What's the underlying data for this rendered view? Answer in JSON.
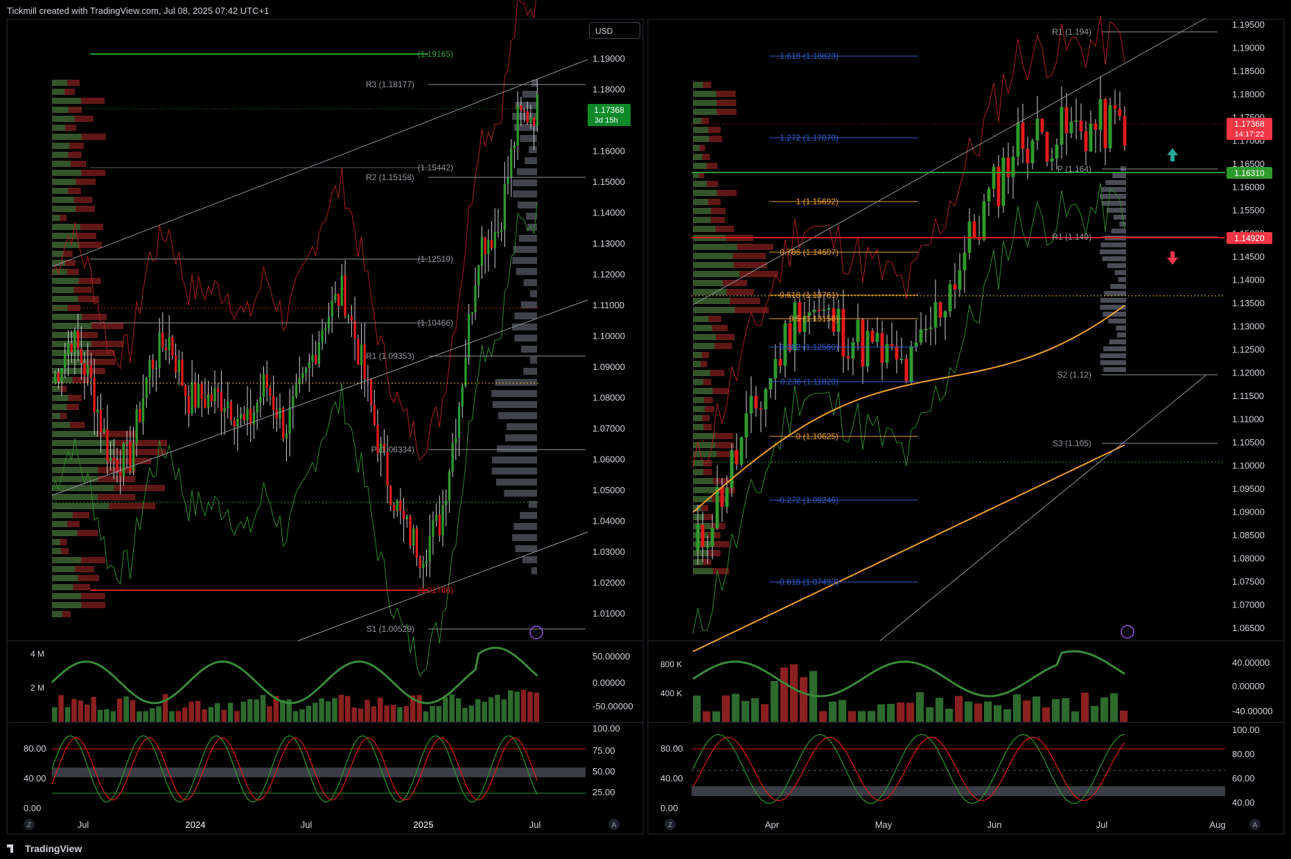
{
  "header": {
    "attribution": "Tickmill created with TradingView.com, Jul 08, 2025 07:42 UTC+1"
  },
  "footer": {
    "brand": "TradingView"
  },
  "colors": {
    "bull": "#2e8b2e",
    "bear": "#e21b1b",
    "grid": "#1c1f26",
    "text": "#d1d4dc",
    "pivot": "#9598a1",
    "fib_blue": "#2f5fd0",
    "fib_orange": "#f0a030"
  },
  "left_panel": {
    "currency_button": "USD",
    "price_axis": [
      "1.19000",
      "1.18000",
      "1.17000",
      "1.16000",
      "1.15000",
      "1.14000",
      "1.13000",
      "1.12000",
      "1.11000",
      "1.10000",
      "1.09000",
      "1.08000",
      "1.07000",
      "1.06000",
      "1.05000",
      "1.04000",
      "1.03000",
      "1.02000",
      "1.01000"
    ],
    "price_badge": {
      "price": "1.17368",
      "countdown": "3d 15h"
    },
    "time_axis": [
      "Jul",
      "2024",
      "Jul",
      "2025",
      "Jul"
    ],
    "level_labels": [
      "(1.19165)",
      "R3 (1.18177)",
      "(1.15442)",
      "R2 (1.15158)",
      "(1.12519)",
      "(1.10466)",
      "R1 (1.09353)",
      "P (1.06334)",
      "(1.01766)",
      "S1 (1.00529)"
    ],
    "volume_axis": [
      "4 M",
      "2 M"
    ],
    "oscillator_axis": [
      "50.00000",
      "0.00000",
      "-50.00000"
    ],
    "stoch_axis_left": [
      "80.00",
      "40.00",
      "0.00"
    ],
    "stoch_axis_right": [
      "100.00",
      "75.00",
      "50.00",
      "25.00"
    ]
  },
  "right_panel": {
    "price_axis": [
      "1.19500",
      "1.19000",
      "1.18500",
      "1.18000",
      "1.17500",
      "1.17000",
      "1.16500",
      "1.16000",
      "1.15500",
      "1.15000",
      "1.14500",
      "1.14000",
      "1.13500",
      "1.13000",
      "1.12500",
      "1.12000",
      "1.11500",
      "1.11000",
      "1.10500",
      "1.10000",
      "1.09500",
      "1.09000",
      "1.08500",
      "1.08000",
      "1.07500",
      "1.07000",
      "1.06500"
    ],
    "price_badge": {
      "price": "1.17368",
      "countdown": "14:17:22"
    },
    "level_badges": [
      "1.16310",
      "1.14920"
    ],
    "time_axis": [
      "Apr",
      "May",
      "Jun",
      "Jul",
      "Aug"
    ],
    "fib_labels": [
      "1.618 (1.18823)",
      "1.272 (1.17070)",
      "1 (1.15692)",
      "0.786 (1.14607)",
      "0.618 (1.13761)",
      "0.5 (1.13158)",
      "0.382 (1.12560)",
      "0.236 (1.11820)",
      "0 (1.10625)",
      "-0.272 (1.09246)",
      "-0.618 (1.07493)"
    ],
    "pivot_labels": [
      "R1 (1.194)",
      "P (1.164)",
      "R1 (1.149)",
      "S2 (1.12)",
      "S3 (1.105)"
    ],
    "volume_axis": [
      "800 K",
      "400 K"
    ],
    "oscillator_axis": [
      "40.00000",
      "0.00000",
      "-40.00000"
    ],
    "stoch_axis_left": [
      "80.00",
      "40.00",
      "0.00"
    ],
    "stoch_axis_right": [
      "100.00",
      "80.00",
      "60.00",
      "40.00"
    ]
  },
  "chart_data": [
    {
      "type": "candlestick",
      "title": "",
      "xlabel": "",
      "ylabel": "",
      "x": [
        "2023-06",
        "2023-07",
        "2023-08",
        "2023-09",
        "2023-10",
        "2023-11",
        "2023-12",
        "2024-01",
        "2024-02",
        "2024-03",
        "2024-04",
        "2024-05",
        "2024-06",
        "2024-07",
        "2024-08",
        "2024-09",
        "2024-10",
        "2024-11",
        "2024-12",
        "2025-01",
        "2025-02",
        "2025-03",
        "2025-04",
        "2025-05",
        "2025-06",
        "2025-07"
      ],
      "close": [
        1.085,
        1.1,
        1.085,
        1.06,
        1.06,
        1.09,
        1.1,
        1.08,
        1.08,
        1.08,
        1.07,
        1.085,
        1.07,
        1.085,
        1.105,
        1.115,
        1.09,
        1.06,
        1.04,
        1.03,
        1.04,
        1.08,
        1.13,
        1.135,
        1.17,
        1.174
      ],
      "ylim": [
        1.0,
        1.195
      ],
      "grid": false
    },
    {
      "type": "candlestick",
      "title": "",
      "xlabel": "",
      "ylabel": "",
      "x": [
        "2025-03",
        "2025-04",
        "2025-05",
        "2025-06",
        "2025-07"
      ],
      "close": [
        1.08,
        1.135,
        1.12,
        1.17,
        1.174
      ],
      "ylim": [
        1.063,
        1.197
      ],
      "grid": false
    }
  ]
}
